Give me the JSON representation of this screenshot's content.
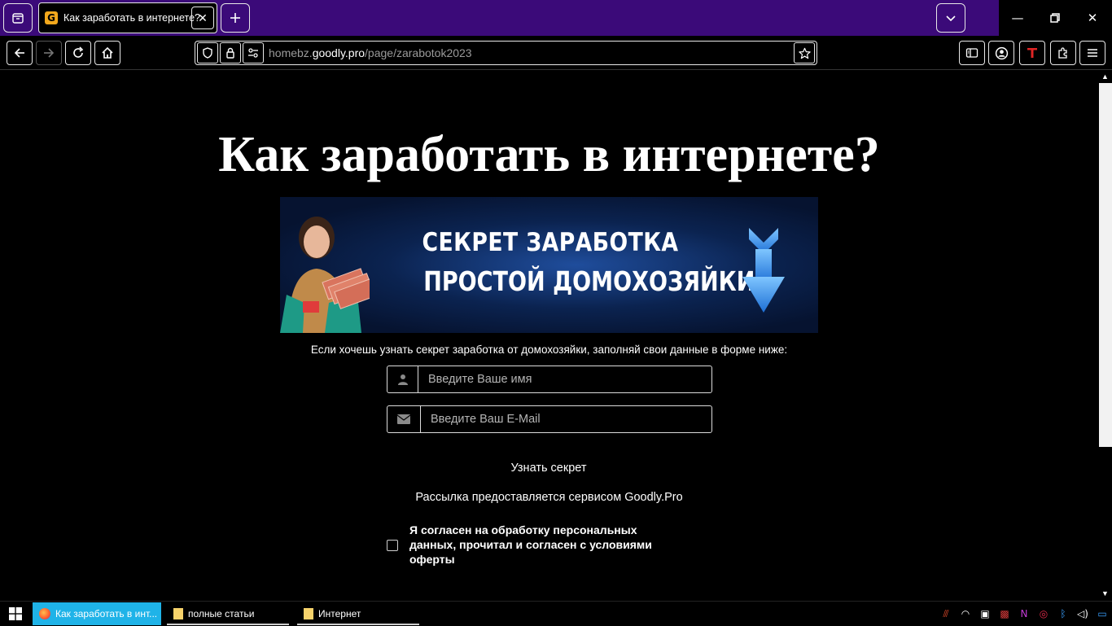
{
  "browser": {
    "tab": {
      "title": "Как заработать в интернете?",
      "favicon_letter": "G"
    },
    "url": {
      "prefix": "homebz.",
      "domain": "goodly.pro",
      "path": "/page/zarabotok2023"
    }
  },
  "page": {
    "heading": "Как заработать в интернете?",
    "banner": {
      "line1": "СЕКРЕТ ЗАРАБОТКА",
      "line2": "ПРОСТОЙ ДОМОХОЗЯЙКИ"
    },
    "intro": "Если хочешь узнать секрет заработка от домохозяйки, заполняй свои данные в форме ниже:",
    "name_placeholder": "Введите Ваше имя",
    "email_placeholder": "Введите Ваш E-Mail",
    "submit_label": "Узнать секрет",
    "service_text": "Рассылка предоставляется сервисом Goodly.Pro",
    "consent_text": "Я согласен на обработку персональных данных, прочитал и согласен с условиями оферты"
  },
  "taskbar": {
    "items": [
      {
        "label": "Как заработать в инт..."
      },
      {
        "label": "полные статьи"
      },
      {
        "label": "Интернет"
      }
    ]
  },
  "colors": {
    "tab_strip": "#3b0a79",
    "taskbar_active": "#1fb3e8",
    "banner_bg": "#0b2350"
  },
  "icons": [
    "tab-overview-icon",
    "site-favicon",
    "close-icon",
    "plus-icon",
    "chevron-down-icon",
    "minimize-icon",
    "restore-icon",
    "window-close-icon",
    "back-icon",
    "forward-icon",
    "reload-icon",
    "home-icon",
    "shield-icon",
    "lock-icon",
    "permissions-icon",
    "star-icon",
    "sidebar-icon",
    "account-icon",
    "extension-t-icon",
    "extensions-icon",
    "menu-icon",
    "user-icon",
    "envelope-icon",
    "windows-start-icon"
  ]
}
